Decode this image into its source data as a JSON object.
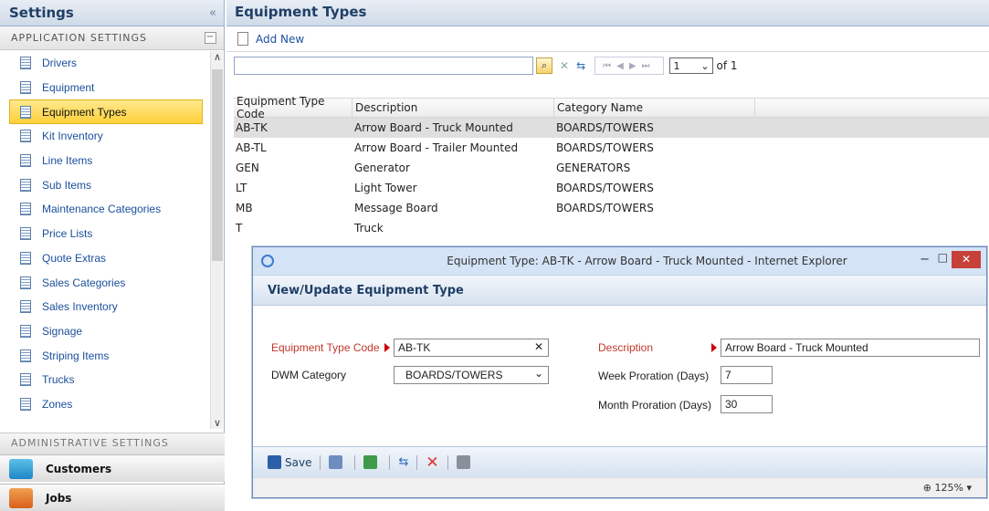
{
  "sidebar": {
    "title": "Settings",
    "collapse_glyph": "«",
    "app_settings_label": "APPLICATION SETTINGS",
    "items": [
      {
        "label": "Drivers"
      },
      {
        "label": "Equipment"
      },
      {
        "label": "Equipment Types"
      },
      {
        "label": "Kit Inventory"
      },
      {
        "label": "Line Items"
      },
      {
        "label": "Sub Items"
      },
      {
        "label": "Maintenance Categories"
      },
      {
        "label": "Price Lists"
      },
      {
        "label": "Quote Extras"
      },
      {
        "label": "Sales Categories"
      },
      {
        "label": "Sales Inventory"
      },
      {
        "label": "Signage"
      },
      {
        "label": "Striping Items"
      },
      {
        "label": "Trucks"
      },
      {
        "label": "Zones"
      }
    ],
    "selected_item": "Equipment Types",
    "admin_settings_label": "ADMINISTRATIVE SETTINGS",
    "customers_label": "Customers",
    "jobs_label": "Jobs"
  },
  "main": {
    "title": "Equipment Types",
    "add_new_label": "Add New",
    "pager": {
      "page": "1",
      "of_label": "of 1"
    },
    "columns": [
      "Equipment Type Code",
      "Description",
      "Category Name"
    ],
    "rows": [
      {
        "code": "AB-TK",
        "description": "Arrow Board - Truck Mounted",
        "category": "BOARDS/TOWERS"
      },
      {
        "code": "AB-TL",
        "description": "Arrow Board - Trailer Mounted",
        "category": "BOARDS/TOWERS"
      },
      {
        "code": "GEN",
        "description": "Generator",
        "category": "GENERATORS"
      },
      {
        "code": "LT",
        "description": "Light Tower",
        "category": "BOARDS/TOWERS"
      },
      {
        "code": "MB",
        "description": "Message Board",
        "category": "BOARDS/TOWERS"
      },
      {
        "code": "T",
        "description": "Truck",
        "category": ""
      }
    ]
  },
  "dialog": {
    "window_title": "Equipment Type: AB-TK - Arrow Board - Truck Mounted - Internet Explorer",
    "header": "View/Update Equipment Type",
    "type_code_label": "Equipment Type Code",
    "type_code_value": "AB-TK",
    "dwm_category_label": "DWM Category",
    "dwm_category_value": "BOARDS/TOWERS",
    "description_label": "Description",
    "description_value": "Arrow Board - Truck Mounted",
    "week_proration_label": "Week Proration (Days)",
    "week_proration_value": "7",
    "month_proration_label": "Month Proration (Days)",
    "month_proration_value": "30",
    "save_label": "Save",
    "zoom_label": "125%"
  },
  "colors": {
    "accent": "#1f3f66",
    "selection": "#ffd13a",
    "required": "#c0392b"
  }
}
